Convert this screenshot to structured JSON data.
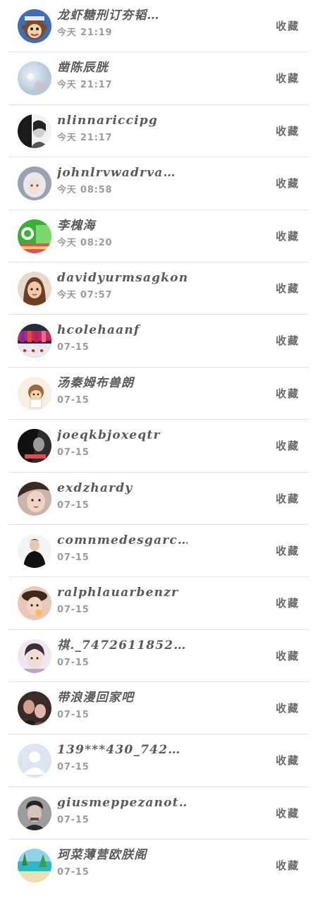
{
  "items": [
    {
      "name": "龙虾糖刑订夯韬…",
      "time": "今天 21:19",
      "action": "收藏",
      "avatar": "cartoon-monkey"
    },
    {
      "name": "凿陈辰胱",
      "time": "今天 21:17",
      "action": "收藏",
      "avatar": "soft-blur"
    },
    {
      "name": "nlinnariccipg",
      "time": "今天 21:17",
      "action": "收藏",
      "avatar": "bw-portrait"
    },
    {
      "name": "johnlrvwadrva…",
      "time": "今天 08:58",
      "action": "收藏",
      "avatar": "white-hair-doll"
    },
    {
      "name": "李槐海",
      "time": "今天 08:20",
      "action": "收藏",
      "avatar": "green-app-logo"
    },
    {
      "name": "davidyurmsagkon",
      "time": "今天 07:57",
      "action": "收藏",
      "avatar": "girl-portrait"
    },
    {
      "name": "hcolehaanf",
      "time": "07-15",
      "action": "收藏",
      "avatar": "lipsticks"
    },
    {
      "name": "汤秦姆布兽朗",
      "time": "07-15",
      "action": "收藏",
      "avatar": "cartoon-character"
    },
    {
      "name": "joeqkbjoxeqtr",
      "time": "07-15",
      "action": "收藏",
      "avatar": "dark-photo"
    },
    {
      "name": "exdzhardy",
      "time": "07-15",
      "action": "收藏",
      "avatar": "woman-closeup"
    },
    {
      "name": "comnmedesgarc…",
      "time": "07-15",
      "action": "收藏",
      "avatar": "woman-black-outfit"
    },
    {
      "name": "ralphlauarbenzr",
      "time": "07-15",
      "action": "收藏",
      "avatar": "girl-with-hat"
    },
    {
      "name": "祺._7472611852…",
      "time": "07-15",
      "action": "收藏",
      "avatar": "young-man"
    },
    {
      "name": "带浪漫回家吧",
      "time": "07-15",
      "action": "收藏",
      "avatar": "couple-photo"
    },
    {
      "name": "139***430_742…",
      "time": "07-15",
      "action": "收藏",
      "avatar": "default-user"
    },
    {
      "name": "giusmeppezanot…",
      "time": "07-15",
      "action": "收藏",
      "avatar": "man-portrait"
    },
    {
      "name": "珂菜薄营欧朕阁",
      "time": "07-15",
      "action": "收藏",
      "avatar": "beach-scene"
    }
  ],
  "colors": {
    "name_text": "#5a5a5a",
    "time_text": "#9b9b9b",
    "action_text": "#6b6b6b",
    "divider": "#e3e3e3"
  }
}
